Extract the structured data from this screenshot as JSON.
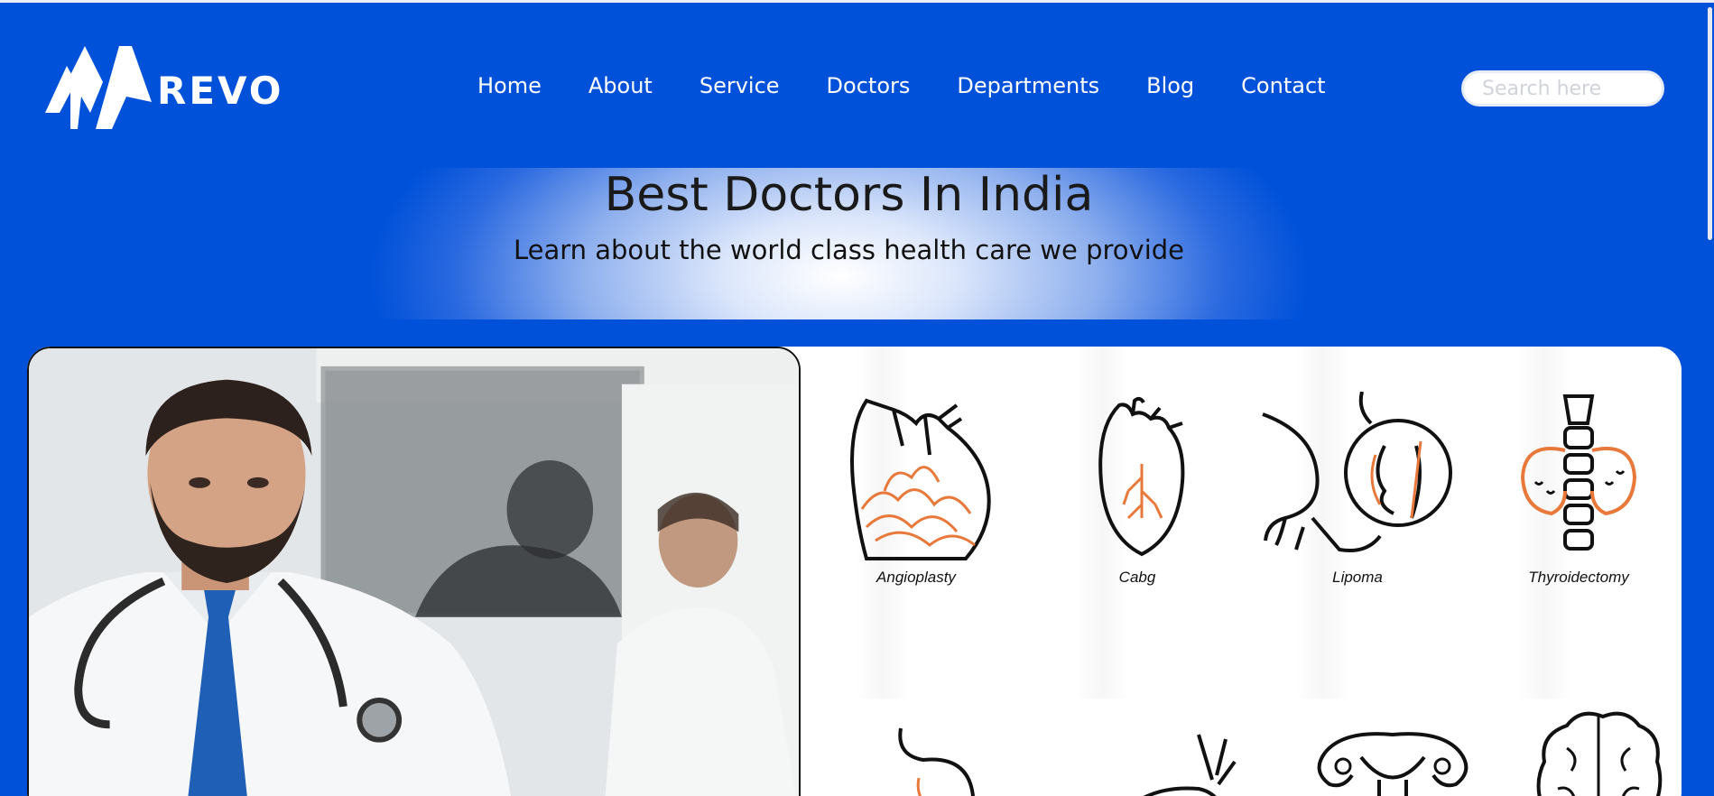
{
  "brand": {
    "name": "REVO"
  },
  "nav": {
    "items": [
      "Home",
      "About",
      "Service",
      "Doctors",
      "Departments",
      "Blog",
      "Contact"
    ]
  },
  "search": {
    "placeholder": "Search here",
    "value": ""
  },
  "hero": {
    "title": "Best Doctors In India",
    "subtitle": "Learn about the world class health care we provide"
  },
  "services": {
    "items": [
      {
        "label": "Angioplasty",
        "icon": "heart-vessels-icon"
      },
      {
        "label": "Cabg",
        "icon": "heart-bypass-icon"
      },
      {
        "label": "Lipoma",
        "icon": "lipoma-icon"
      },
      {
        "label": "Thyroidectomy",
        "icon": "thyroid-icon"
      }
    ],
    "row2_icons": [
      "stomach-icon",
      "kidney-icon",
      "uterus-icon",
      "brain-icon"
    ]
  },
  "colors": {
    "primary": "#0051d9",
    "accent": "#e8793a",
    "text": "#111111"
  }
}
